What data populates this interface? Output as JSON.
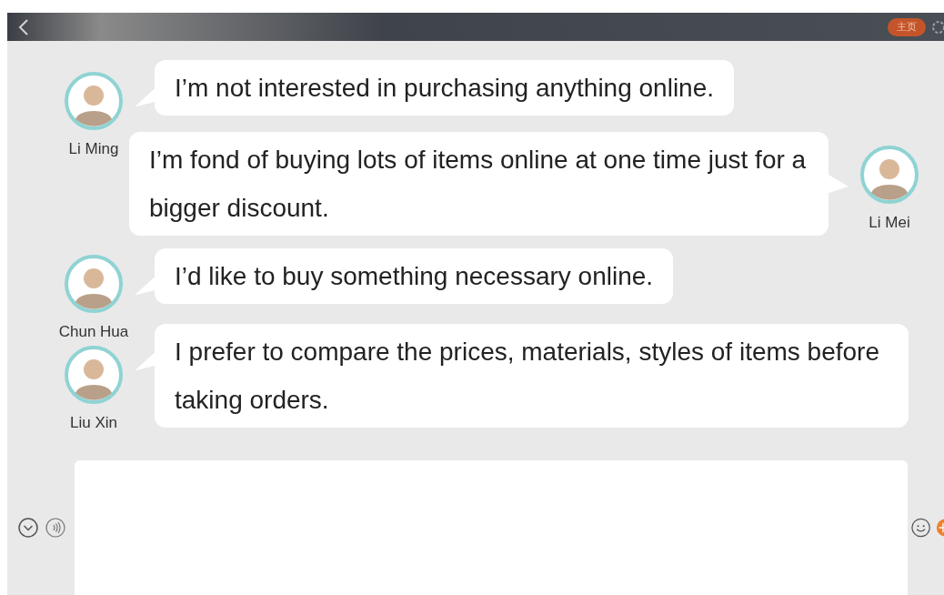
{
  "top_bar": {
    "home_button": "主页"
  },
  "messages": [
    {
      "name": "Li Ming",
      "kind": "incoming",
      "text": "I’m not interested in purchasing anything online."
    },
    {
      "name": "Li Mei",
      "kind": "outgoing",
      "text": "I’m fond of buying lots of items online at one time just for a bigger discount."
    },
    {
      "name": "Chun Hua",
      "kind": "incoming",
      "text": "I’d like to buy something necessary online."
    },
    {
      "name": "Liu Xin",
      "kind": "incoming",
      "text": "I prefer to compare the prices, materials, styles of items before taking orders."
    }
  ]
}
